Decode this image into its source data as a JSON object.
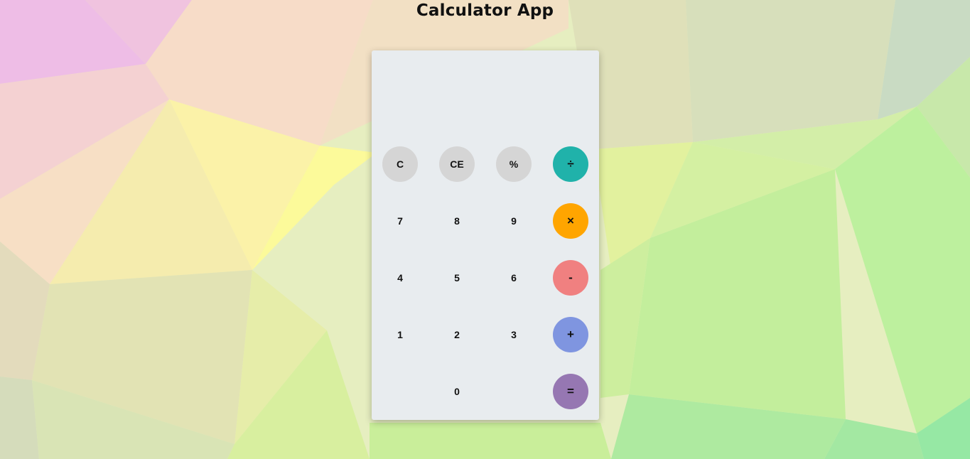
{
  "app": {
    "title": "Calculator App"
  },
  "display": {
    "value": ""
  },
  "keys": {
    "clear": "C",
    "clear_entry": "CE",
    "percent": "%",
    "divide": "÷",
    "seven": "7",
    "eight": "8",
    "nine": "9",
    "multiply": "×",
    "four": "4",
    "five": "5",
    "six": "6",
    "subtract": "-",
    "one": "1",
    "two": "2",
    "three": "3",
    "add": "+",
    "zero": "0",
    "equals": "="
  },
  "colors": {
    "function_keys": "#d5d5d5",
    "divide": "#20b2aa",
    "multiply": "#ffa500",
    "subtract": "#f08080",
    "add": "#7f95e0",
    "equals": "#9677b2",
    "panel": "#e8ecef"
  }
}
